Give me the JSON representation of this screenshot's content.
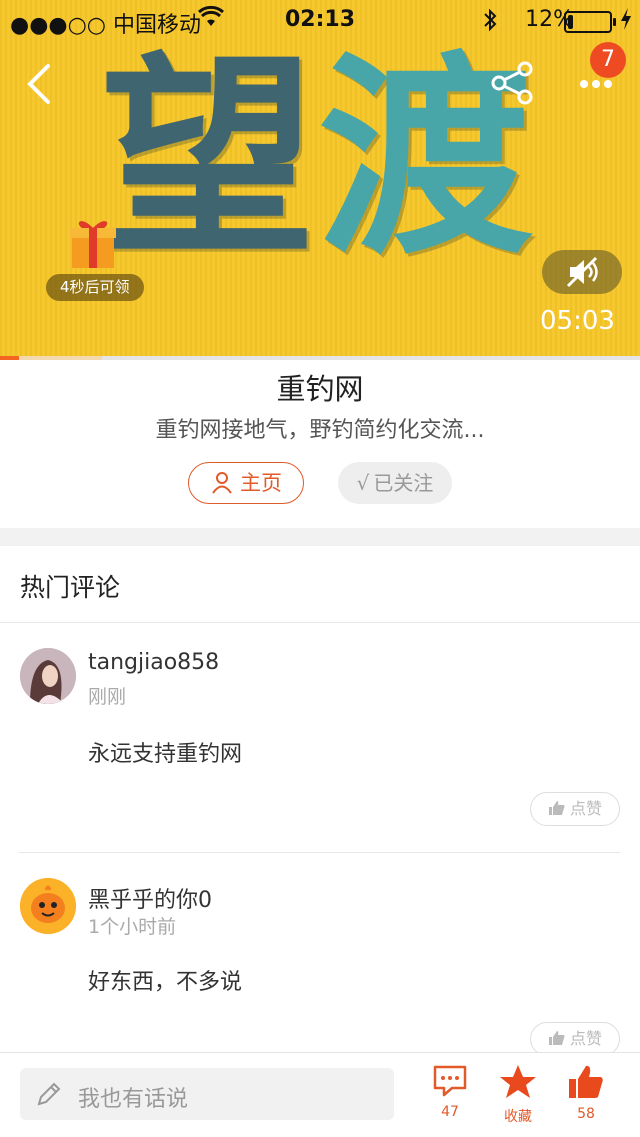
{
  "status_bar": {
    "carrier": "●●●○○ 中国移动",
    "time": "02:13",
    "battery": "12%",
    "battery_level": 0.12
  },
  "video": {
    "title_chars": [
      "望",
      "渡"
    ],
    "gift_label": "4秒后可领",
    "notification_count": "7",
    "duration": "05:03",
    "played_fraction": 0.03,
    "buffered_fraction": 0.16,
    "colors": {
      "background": "#f7c72a",
      "accent": "#f26522"
    }
  },
  "channel": {
    "name": "重钓网",
    "description": "重钓网接地气，野钓简约化交流...",
    "home_label": "主页",
    "follow_label": "已关注",
    "check_mark": "√"
  },
  "comments_section": {
    "title": "热门评论",
    "comments": [
      {
        "username": "tangjiao858",
        "time": "刚刚",
        "text": "永远支持重钓网",
        "like_label": "点赞"
      },
      {
        "username": "黑乎乎的你0",
        "time": "1个小时前",
        "text": "好东西，不多说",
        "like_label": "点赞"
      }
    ]
  },
  "bottom_bar": {
    "input_placeholder": "我也有话说",
    "comment_count": "47",
    "favorite_label": "收藏",
    "like_count": "58"
  }
}
